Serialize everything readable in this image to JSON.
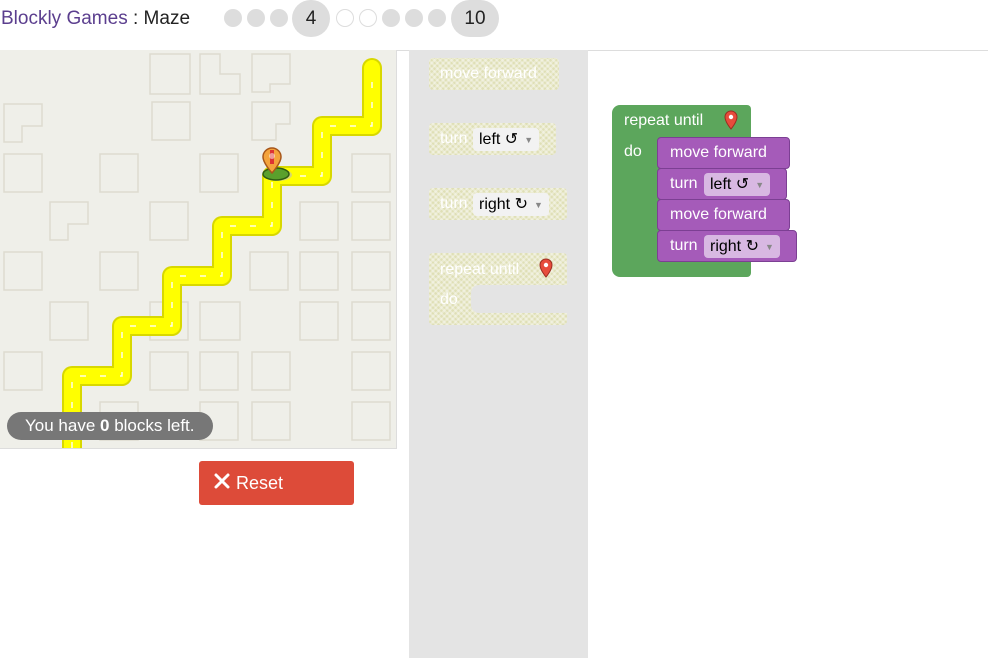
{
  "header": {
    "app_name": "Blockly Games",
    "separator": " : ",
    "game_name": "Maze",
    "current_level": "4",
    "last_level": "10"
  },
  "maze": {
    "capacity_prefix": "You have ",
    "capacity_count": "0",
    "capacity_suffix": " blocks left.",
    "path_color": "#ffff00",
    "player_color": "#f4a33c"
  },
  "controls": {
    "reset_label": "Reset",
    "reset_icon": "close-icon"
  },
  "toolbox": {
    "move_forward": "move forward",
    "turn_left_label": "turn",
    "turn_left_value": "left ↺",
    "turn_right_label": "turn",
    "turn_right_value": "right ↻",
    "repeat_until": "repeat until",
    "do": "do"
  },
  "workspace": {
    "repeat_until": "repeat until",
    "do": "do",
    "statements": [
      {
        "label": "move forward"
      },
      {
        "label": "turn",
        "value": "left ↺"
      },
      {
        "label": "move forward"
      },
      {
        "label": "turn",
        "value": "right ↻"
      }
    ]
  },
  "colors": {
    "loop_block": "#5ca65c",
    "movement_block": "#a55bb9",
    "reset_button": "#dd4b39",
    "toolbox_bg": "#e4e4e4",
    "title_link": "#5b3e8e"
  }
}
